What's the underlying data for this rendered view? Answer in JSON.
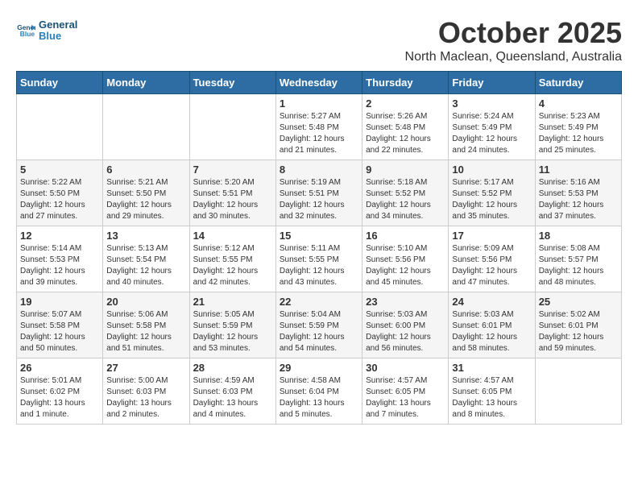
{
  "header": {
    "logo_line1": "General",
    "logo_line2": "Blue",
    "title": "October 2025",
    "subtitle": "North Maclean, Queensland, Australia"
  },
  "weekdays": [
    "Sunday",
    "Monday",
    "Tuesday",
    "Wednesday",
    "Thursday",
    "Friday",
    "Saturday"
  ],
  "weeks": [
    [
      {
        "day": "",
        "info": ""
      },
      {
        "day": "",
        "info": ""
      },
      {
        "day": "",
        "info": ""
      },
      {
        "day": "1",
        "info": "Sunrise: 5:27 AM\nSunset: 5:48 PM\nDaylight: 12 hours\nand 21 minutes."
      },
      {
        "day": "2",
        "info": "Sunrise: 5:26 AM\nSunset: 5:48 PM\nDaylight: 12 hours\nand 22 minutes."
      },
      {
        "day": "3",
        "info": "Sunrise: 5:24 AM\nSunset: 5:49 PM\nDaylight: 12 hours\nand 24 minutes."
      },
      {
        "day": "4",
        "info": "Sunrise: 5:23 AM\nSunset: 5:49 PM\nDaylight: 12 hours\nand 25 minutes."
      }
    ],
    [
      {
        "day": "5",
        "info": "Sunrise: 5:22 AM\nSunset: 5:50 PM\nDaylight: 12 hours\nand 27 minutes."
      },
      {
        "day": "6",
        "info": "Sunrise: 5:21 AM\nSunset: 5:50 PM\nDaylight: 12 hours\nand 29 minutes."
      },
      {
        "day": "7",
        "info": "Sunrise: 5:20 AM\nSunset: 5:51 PM\nDaylight: 12 hours\nand 30 minutes."
      },
      {
        "day": "8",
        "info": "Sunrise: 5:19 AM\nSunset: 5:51 PM\nDaylight: 12 hours\nand 32 minutes."
      },
      {
        "day": "9",
        "info": "Sunrise: 5:18 AM\nSunset: 5:52 PM\nDaylight: 12 hours\nand 34 minutes."
      },
      {
        "day": "10",
        "info": "Sunrise: 5:17 AM\nSunset: 5:52 PM\nDaylight: 12 hours\nand 35 minutes."
      },
      {
        "day": "11",
        "info": "Sunrise: 5:16 AM\nSunset: 5:53 PM\nDaylight: 12 hours\nand 37 minutes."
      }
    ],
    [
      {
        "day": "12",
        "info": "Sunrise: 5:14 AM\nSunset: 5:53 PM\nDaylight: 12 hours\nand 39 minutes."
      },
      {
        "day": "13",
        "info": "Sunrise: 5:13 AM\nSunset: 5:54 PM\nDaylight: 12 hours\nand 40 minutes."
      },
      {
        "day": "14",
        "info": "Sunrise: 5:12 AM\nSunset: 5:55 PM\nDaylight: 12 hours\nand 42 minutes."
      },
      {
        "day": "15",
        "info": "Sunrise: 5:11 AM\nSunset: 5:55 PM\nDaylight: 12 hours\nand 43 minutes."
      },
      {
        "day": "16",
        "info": "Sunrise: 5:10 AM\nSunset: 5:56 PM\nDaylight: 12 hours\nand 45 minutes."
      },
      {
        "day": "17",
        "info": "Sunrise: 5:09 AM\nSunset: 5:56 PM\nDaylight: 12 hours\nand 47 minutes."
      },
      {
        "day": "18",
        "info": "Sunrise: 5:08 AM\nSunset: 5:57 PM\nDaylight: 12 hours\nand 48 minutes."
      }
    ],
    [
      {
        "day": "19",
        "info": "Sunrise: 5:07 AM\nSunset: 5:58 PM\nDaylight: 12 hours\nand 50 minutes."
      },
      {
        "day": "20",
        "info": "Sunrise: 5:06 AM\nSunset: 5:58 PM\nDaylight: 12 hours\nand 51 minutes."
      },
      {
        "day": "21",
        "info": "Sunrise: 5:05 AM\nSunset: 5:59 PM\nDaylight: 12 hours\nand 53 minutes."
      },
      {
        "day": "22",
        "info": "Sunrise: 5:04 AM\nSunset: 5:59 PM\nDaylight: 12 hours\nand 54 minutes."
      },
      {
        "day": "23",
        "info": "Sunrise: 5:03 AM\nSunset: 6:00 PM\nDaylight: 12 hours\nand 56 minutes."
      },
      {
        "day": "24",
        "info": "Sunrise: 5:03 AM\nSunset: 6:01 PM\nDaylight: 12 hours\nand 58 minutes."
      },
      {
        "day": "25",
        "info": "Sunrise: 5:02 AM\nSunset: 6:01 PM\nDaylight: 12 hours\nand 59 minutes."
      }
    ],
    [
      {
        "day": "26",
        "info": "Sunrise: 5:01 AM\nSunset: 6:02 PM\nDaylight: 13 hours\nand 1 minute."
      },
      {
        "day": "27",
        "info": "Sunrise: 5:00 AM\nSunset: 6:03 PM\nDaylight: 13 hours\nand 2 minutes."
      },
      {
        "day": "28",
        "info": "Sunrise: 4:59 AM\nSunset: 6:03 PM\nDaylight: 13 hours\nand 4 minutes."
      },
      {
        "day": "29",
        "info": "Sunrise: 4:58 AM\nSunset: 6:04 PM\nDaylight: 13 hours\nand 5 minutes."
      },
      {
        "day": "30",
        "info": "Sunrise: 4:57 AM\nSunset: 6:05 PM\nDaylight: 13 hours\nand 7 minutes."
      },
      {
        "day": "31",
        "info": "Sunrise: 4:57 AM\nSunset: 6:05 PM\nDaylight: 13 hours\nand 8 minutes."
      },
      {
        "day": "",
        "info": ""
      }
    ]
  ]
}
